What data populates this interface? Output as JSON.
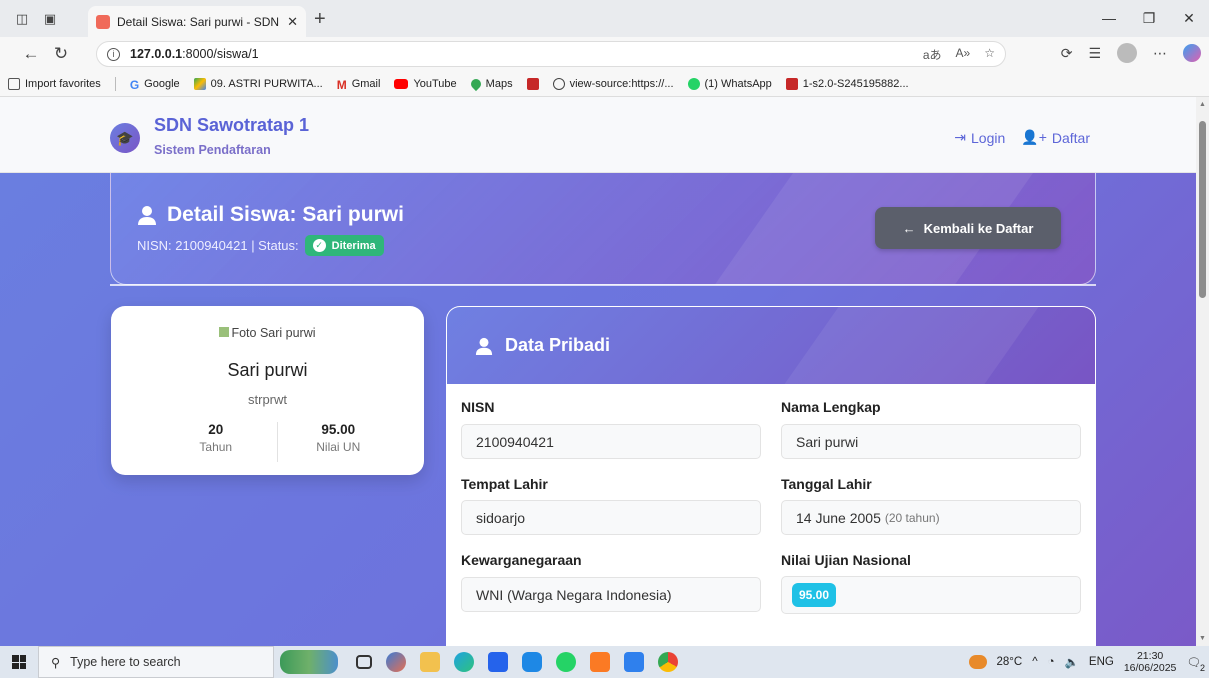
{
  "browser": {
    "tab_title": "Detail Siswa: Sari purwi - SDN Saw",
    "url_host": "127.0.0.1",
    "url_rest": ":8000/siswa/1",
    "bookmarks": [
      "Import favorites",
      "Google",
      "09. ASTRI PURWITA...",
      "Gmail",
      "YouTube",
      "Maps",
      "",
      "view-source:https://...",
      "(1) WhatsApp",
      "1-s2.0-S245195882..."
    ]
  },
  "navbar": {
    "brand": "SDN Sawotratap 1",
    "subtitle": "Sistem Pendaftaran",
    "login": "Login",
    "register": "Daftar"
  },
  "header": {
    "title": "Detail Siswa: Sari purwi",
    "subtitle": "NISN: 2100940421 | Status:",
    "status": "Diterima",
    "back_button": "Kembali ke Daftar"
  },
  "profile": {
    "photo_alt": "Foto Sari purwi",
    "name": "Sari purwi",
    "username": "strprwt",
    "age_value": "20",
    "age_label": "Tahun",
    "score_value": "95.00",
    "score_label": "Nilai UN"
  },
  "personal": {
    "title": "Data Pribadi",
    "nisn_label": "NISN",
    "nisn": "2100940421",
    "name_label": "Nama Lengkap",
    "name": "Sari purwi",
    "birthplace_label": "Tempat Lahir",
    "birthplace": "sidoarjo",
    "birthdate_label": "Tanggal Lahir",
    "birthdate": "14 June 2005",
    "birthdate_age": "(20 tahun)",
    "citizenship_label": "Kewarganegaraan",
    "citizenship": "WNI (Warga Negara Indonesia)",
    "exam_label": "Nilai Ujian Nasional",
    "exam_score": "95.00"
  },
  "taskbar": {
    "search_placeholder": "Type here to search",
    "temperature": "28°C",
    "language": "ENG",
    "time": "21:30",
    "date": "16/06/2025",
    "notification_count": "2"
  }
}
